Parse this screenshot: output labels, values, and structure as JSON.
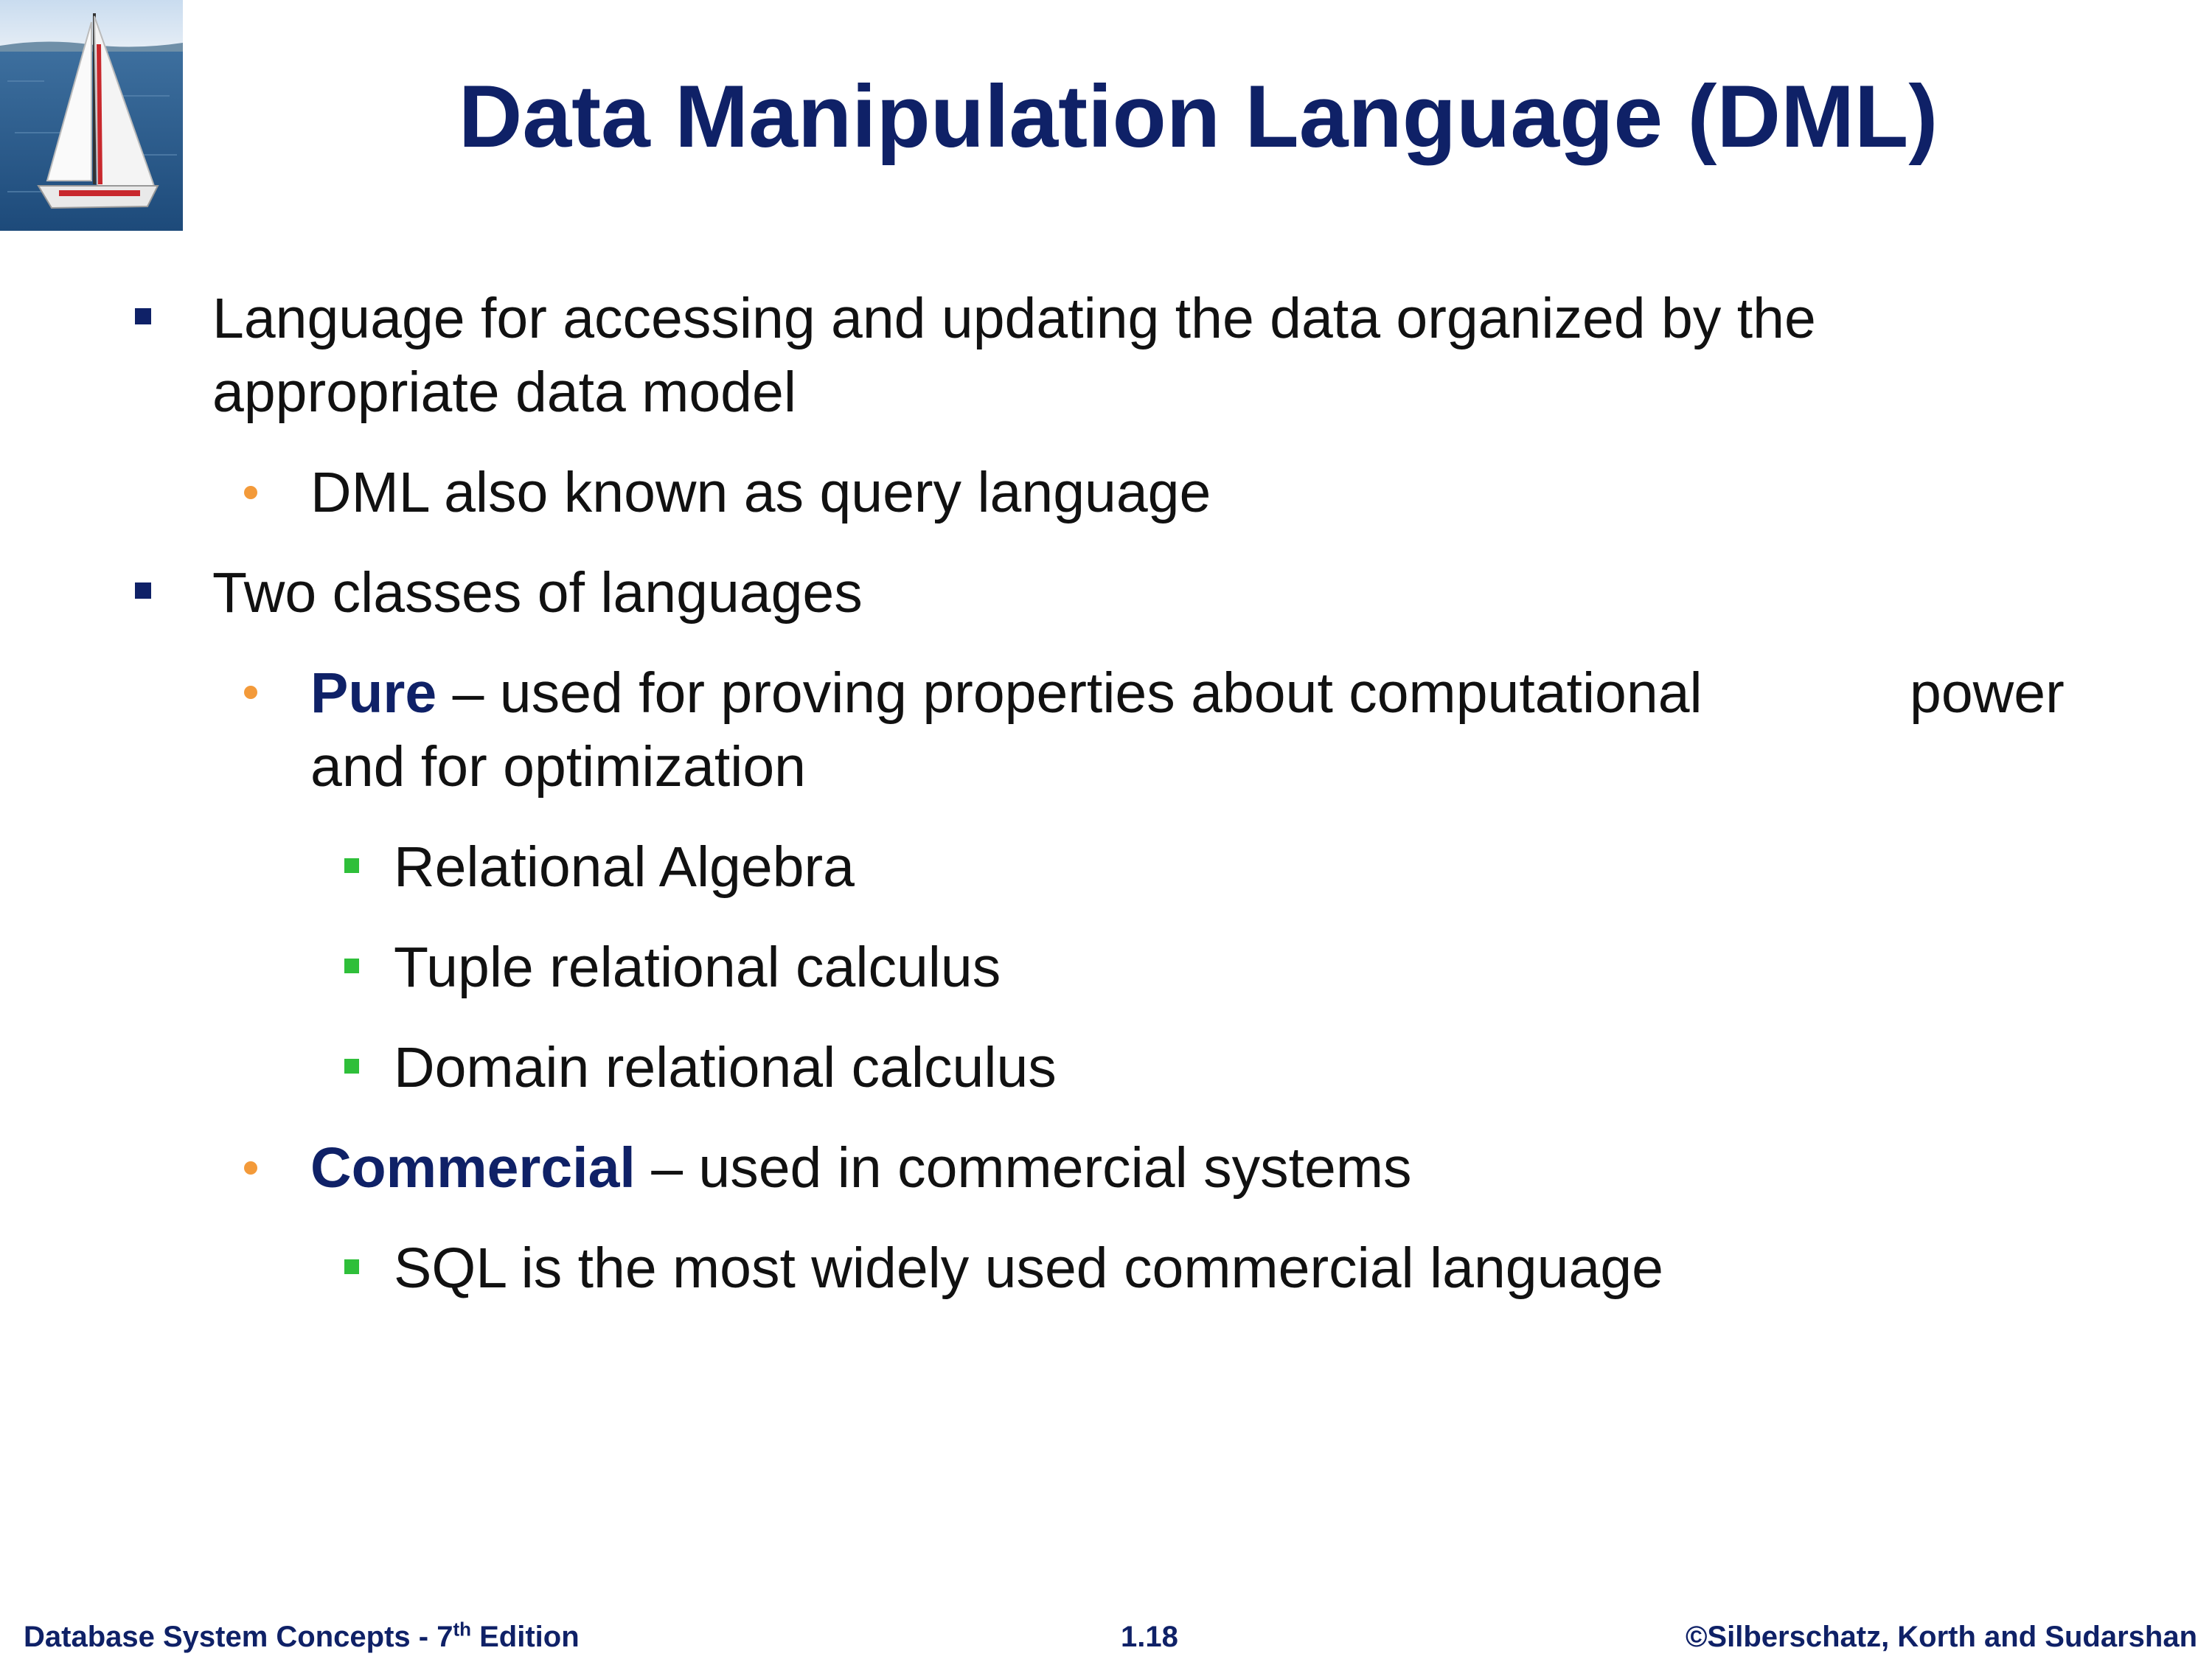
{
  "slide": {
    "title": "Data Manipulation Language (DML)"
  },
  "bullets": [
    {
      "line1": "Language for accessing and updating the data organized by the",
      "line2": "appropriate data model"
    },
    {
      "text": "DML also known as query language"
    },
    {
      "text": "Two classes of languages"
    },
    {
      "term": "Pure",
      "line1_rest": " – used for proving properties about computational",
      "line1_tail": "power",
      "line2": "and for optimization"
    },
    {
      "text": "Relational Algebra"
    },
    {
      "text": "Tuple relational calculus"
    },
    {
      "text": "Domain relational calculus"
    },
    {
      "term": "Commercial",
      "rest": " – used in commercial systems"
    },
    {
      "text": "SQL is the most widely used commercial language"
    }
  ],
  "footer": {
    "left_prefix": "Database System Concepts - 7",
    "left_sup": "th",
    "left_suffix": " Edition",
    "center": "1.18",
    "right": "©Silberschatz, Korth and Sudarshan"
  },
  "colors": {
    "title": "#0f2167",
    "bullet_level1": "#0f2167",
    "bullet_level2": "#f39a3a",
    "bullet_level3": "#2fbf3a"
  },
  "icons": {
    "logo": "sailboat-logo"
  }
}
